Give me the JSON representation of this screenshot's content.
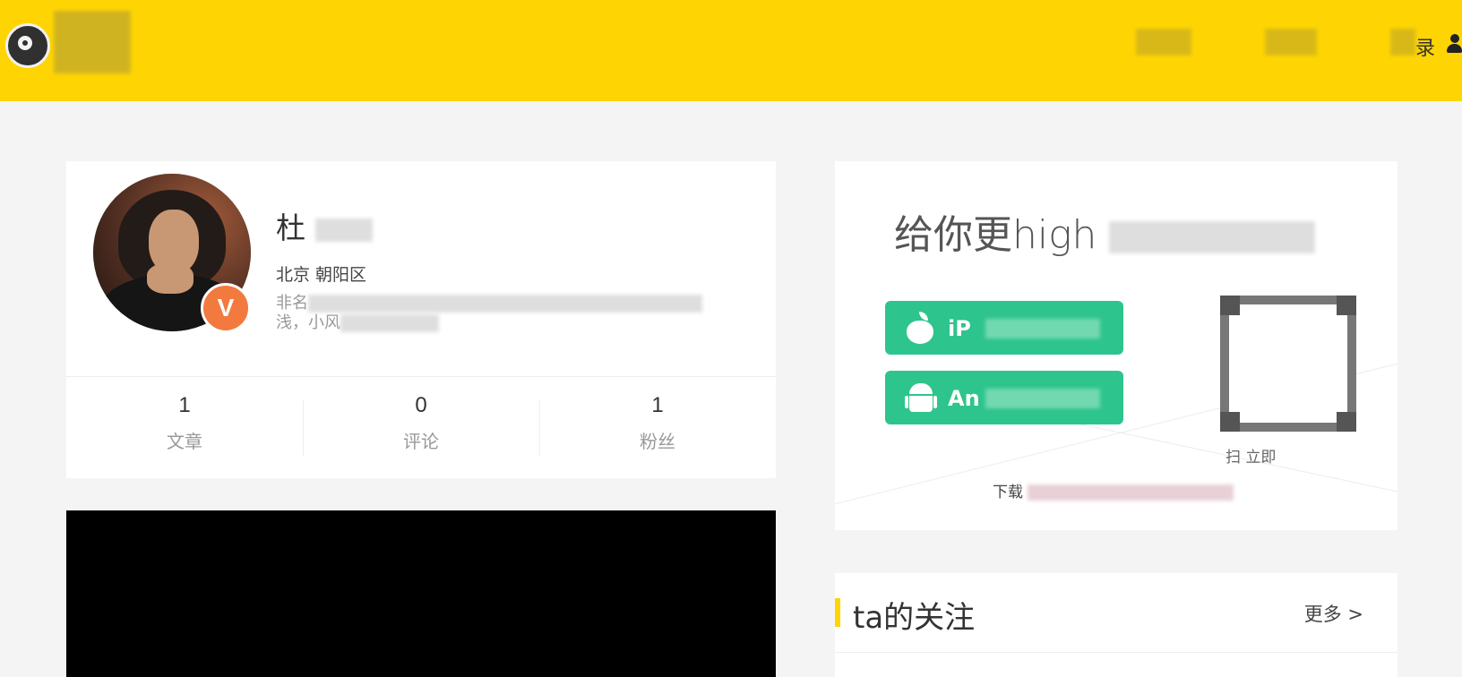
{
  "header": {
    "login_label": "录",
    "colors": {
      "bar": "#fed503"
    }
  },
  "profile": {
    "name_visible": "杜",
    "location": "北京 朝阳区",
    "bio_line1": "非名",
    "bio_line2": "浅，小风",
    "badge": "V",
    "stats": [
      {
        "value": "1",
        "label": "文章"
      },
      {
        "value": "0",
        "label": "评论"
      },
      {
        "value": "1",
        "label": "粉丝"
      }
    ]
  },
  "app_download": {
    "slogan": "给你更high",
    "ios_button_label": "iP",
    "android_button_label": "An",
    "qr_caption": "扫   立即",
    "note": "下载",
    "colors": {
      "button": "#2ec48d"
    }
  },
  "following": {
    "title": "ta的关注",
    "more_label": "更多 >"
  }
}
